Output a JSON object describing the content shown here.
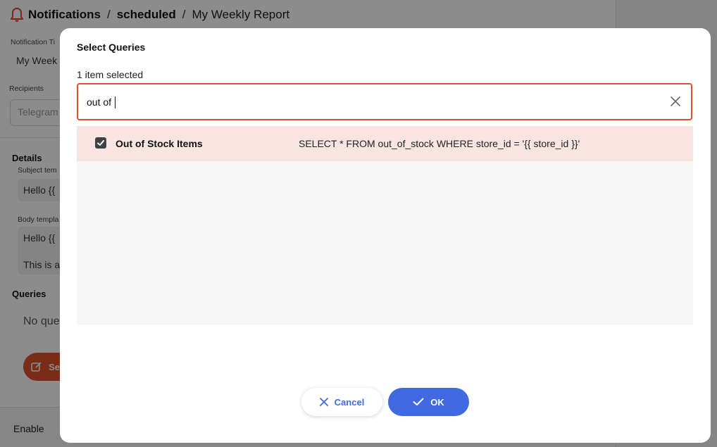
{
  "breadcrumb": {
    "root": "Notifications",
    "section": "scheduled",
    "current": "My Weekly Report",
    "separator": "/"
  },
  "background": {
    "title_label": "Notification Ti",
    "title_value": "My Week",
    "recipients_label": "Recipients",
    "recipients_placeholder": "Telegram",
    "details_heading": "Details",
    "subject_label": "Subject tem",
    "subject_value": "Hello {{",
    "body_label": "Body templa",
    "body_line1": "Hello {{",
    "body_line2": "This is a",
    "queries_heading": "Queries",
    "queries_empty": "No que",
    "select_button": "Se",
    "enable_label": "Enable"
  },
  "modal": {
    "title": "Select Queries",
    "selected_count": "1 item selected",
    "search": {
      "value": "out of",
      "placeholder": ""
    },
    "results": [
      {
        "name": "Out of Stock Items",
        "sql": "SELECT * FROM out_of_stock WHERE store_id = '{{ store_id }}'",
        "checked": true
      }
    ],
    "cancel_label": "Cancel",
    "ok_label": "OK"
  },
  "colors": {
    "accent_blue": "#4169e1",
    "search_border": "#d9552f",
    "selected_row": "#f8e5e2",
    "brand_red": "#e1512f"
  },
  "icons": {
    "bell": "bell-icon",
    "clear": "close-icon",
    "checkbox": "check-icon",
    "cancel": "x-icon",
    "ok": "check-icon",
    "edit": "edit-icon"
  }
}
